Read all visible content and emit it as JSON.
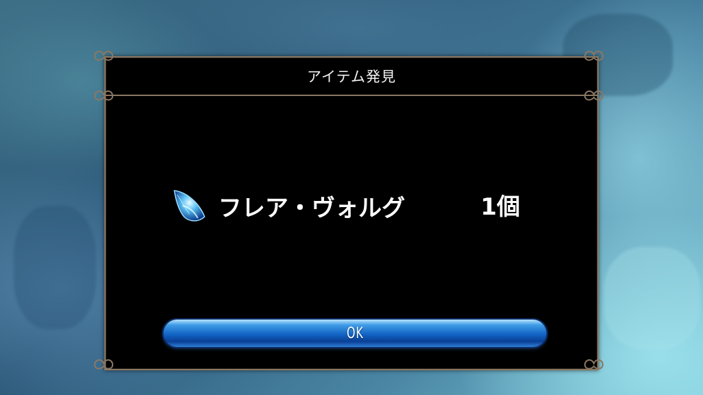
{
  "dialog": {
    "title": "アイテム発見",
    "item": {
      "name": "フレア・ヴォルグ",
      "count": "1個",
      "icon": "blue-crystal-icon"
    },
    "ok_label": "OK"
  },
  "colors": {
    "frame": "#8a7863",
    "dialog_bg": "#000000",
    "button_blue": "#1162c2",
    "text": "#ffffff"
  }
}
